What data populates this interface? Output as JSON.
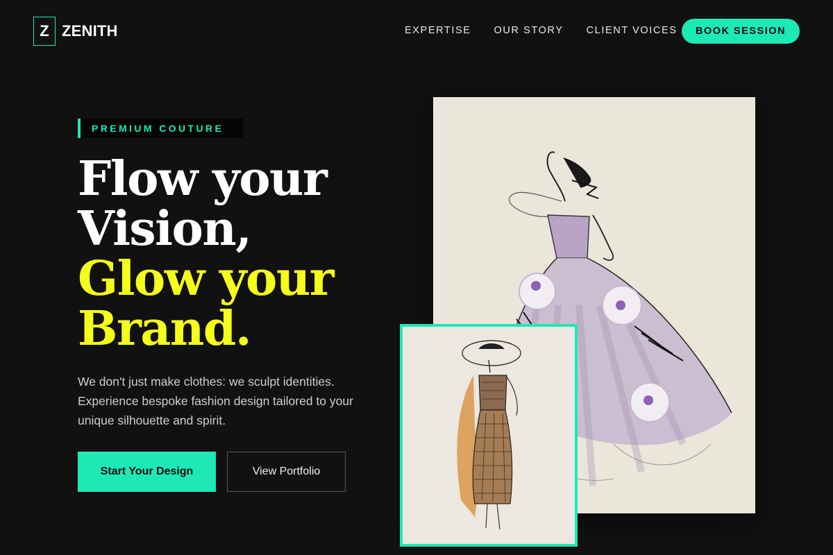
{
  "nav": {
    "logo_letter": "Z",
    "logo_text": "ZENITH",
    "links": [
      "EXPERTISE",
      "OUR STORY",
      "CLIENT VOICES"
    ],
    "cta": "BOOK SESSION"
  },
  "hero": {
    "badge": "PREMIUM COUTURE",
    "headline_line1": "Flow your",
    "headline_line2": "Vision,",
    "headline_line3": "Glow your",
    "headline_line4": "Brand.",
    "description": "We don't just make clothes: we sculpt identities. Experience bespoke fashion design tailored to your unique silhouette and spirit.",
    "primary_button": "Start Your Design",
    "secondary_button": "View Portfolio"
  },
  "colors": {
    "background": "#111112",
    "accent": "#1de9b6",
    "highlight": "#f5ff1a"
  }
}
